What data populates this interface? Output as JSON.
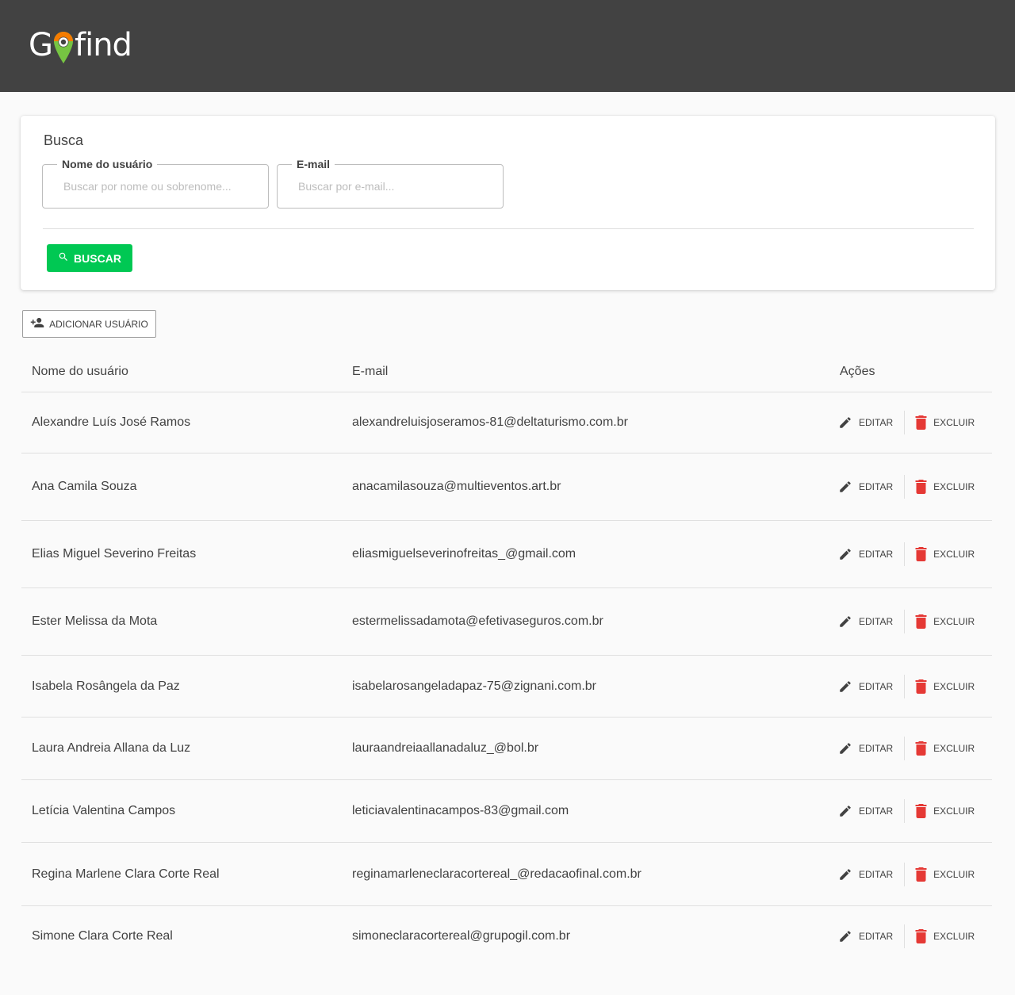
{
  "header": {
    "logo_text_1": "G",
    "logo_text_2": "find",
    "brand_colors": {
      "pin_top": "#f57c00",
      "pin_bottom": "#76c442"
    }
  },
  "search": {
    "title": "Busca",
    "name_label": "Nome do usuário",
    "name_placeholder": "Buscar por nome ou sobrenome...",
    "email_label": "E-mail",
    "email_placeholder": "Buscar por e-mail...",
    "button_label": "BUSCAR",
    "button_icon": "search-icon",
    "button_color": "#00c853"
  },
  "add_user": {
    "label": "ADICIONAR USUÁRIO",
    "icon": "person-add-icon"
  },
  "table": {
    "columns": [
      "Nome do usuário",
      "E-mail",
      "Ações"
    ],
    "edit_label": "EDITAR",
    "delete_label": "EXCLUIR",
    "delete_color": "#e53935",
    "rows": [
      {
        "name": "Alexandre Luís José Ramos",
        "email": "alexandreluisjoseramos-81@deltaturismo.com.br"
      },
      {
        "name": "Ana Camila Souza",
        "email": "anacamilasouza@multieventos.art.br"
      },
      {
        "name": "Elias Miguel Severino Freitas",
        "email": "eliasmiguelseverinofreitas_@gmail.com"
      },
      {
        "name": "Ester Melissa da Mota",
        "email": "estermelissadamota@efetivaseguros.com.br"
      },
      {
        "name": "Isabela Rosângela da Paz",
        "email": "isabelarosangeladapaz-75@zignani.com.br"
      },
      {
        "name": "Laura Andreia Allana da Luz",
        "email": "lauraandreiaallanadaluz_@bol.br"
      },
      {
        "name": "Letícia Valentina Campos",
        "email": "leticiavalentinacampos-83@gmail.com"
      },
      {
        "name": "Regina Marlene Clara Corte Real",
        "email": "reginamarleneclaracortereal_@redacaofinal.com.br"
      },
      {
        "name": "Simone Clara Corte Real",
        "email": "simoneclaracortereal@grupogil.com.br"
      }
    ]
  }
}
